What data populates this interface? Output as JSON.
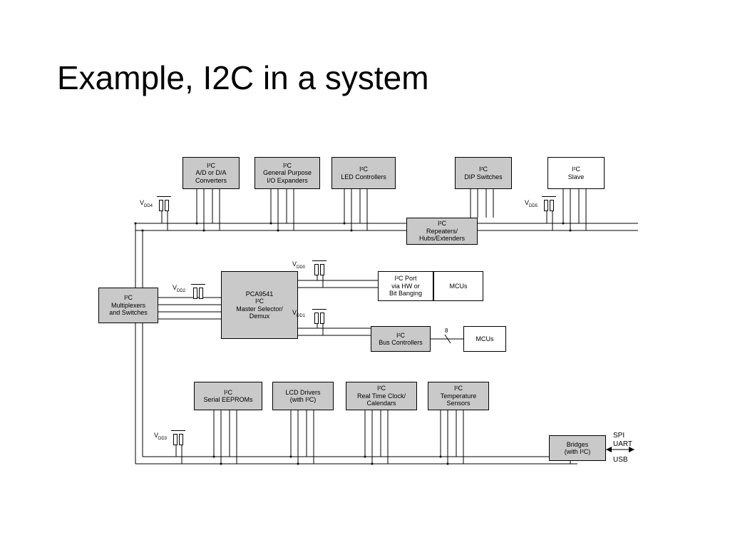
{
  "title": "Example, I2C in a system",
  "nodes": {
    "converters": {
      "l1": "I²C",
      "l2": "A/D or D/A",
      "l3": "Converters"
    },
    "expanders": {
      "l1": "I²C",
      "l2": "General Purpose",
      "l3": "I/O Expanders"
    },
    "led": {
      "l1": "I²C",
      "l2": "LED Controllers"
    },
    "dip": {
      "l1": "I²C",
      "l2": "DIP Switches"
    },
    "slave": {
      "l1": "I²C",
      "l2": "Slave"
    },
    "repeaters": {
      "l1": "I²C",
      "l2": "Repeaters/",
      "l3": "Hubs/Extenders"
    },
    "mux": {
      "l1": "I²C",
      "l2": "Multiplexers",
      "l3": "and Switches"
    },
    "pca": {
      "l1": "PCA9541",
      "l2": "I²C",
      "l3": "Master Selector/",
      "l4": "Demux"
    },
    "port": {
      "l1": "I²C Port",
      "l2": "via HW or",
      "l3": "Bit Banging"
    },
    "mcus1": {
      "l1": "MCUs"
    },
    "busctrl": {
      "l1": "I²C",
      "l2": "Bus Controllers"
    },
    "mcus2": {
      "l1": "MCUs"
    },
    "eeprom": {
      "l1": "I²C",
      "l2": "Serial EEPROMs"
    },
    "lcd": {
      "l1": "LCD Drivers",
      "l2": "(with I²C)"
    },
    "rtc": {
      "l1": "I²C",
      "l2": "Real Time Clock/",
      "l3": "Calendars"
    },
    "temp": {
      "l1": "I²C",
      "l2": "Temperature",
      "l3": "Sensors"
    },
    "bridges": {
      "l1": "Bridges",
      "l2": "(with I²C)"
    }
  },
  "vdd": {
    "v0": "V_DD0",
    "v1": "V_DD1",
    "v2": "V_DD2",
    "v3": "V_DD3",
    "v4": "V_DD4",
    "v5": "V_DD5"
  },
  "ext": {
    "spi": "SPI",
    "uart": "UART",
    "usb": "USB"
  },
  "bus_annot": "8"
}
